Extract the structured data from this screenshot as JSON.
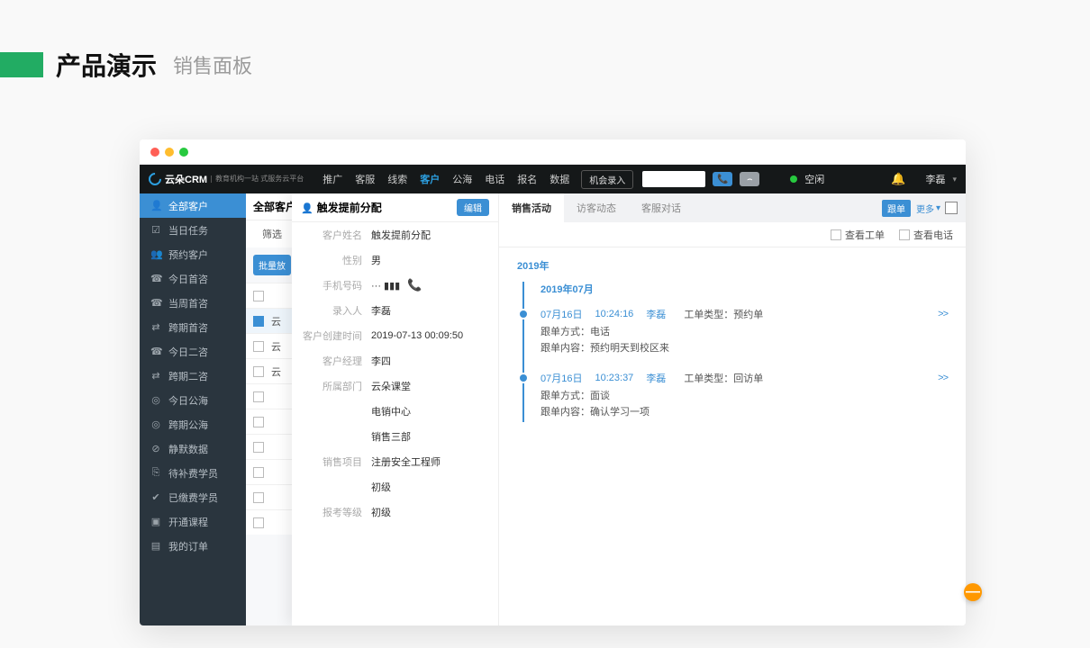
{
  "page": {
    "title_main": "产品演示",
    "title_sub": "销售面板"
  },
  "topnav": {
    "brand_main": "云朵CRM",
    "brand_sub": "教育机构一站\n式服务云平台",
    "items": [
      "推广",
      "客服",
      "线索",
      "客户",
      "公海",
      "电话",
      "报名",
      "数据"
    ],
    "active_index": 3,
    "entry_btn": "机会录入",
    "status_text": "空闲",
    "user": "李磊"
  },
  "sidebar": {
    "items": [
      {
        "icon": "👤",
        "label": "全部客户",
        "active": true
      },
      {
        "icon": "☑",
        "label": "当日任务"
      },
      {
        "icon": "👥",
        "label": "预约客户"
      },
      {
        "icon": "☎",
        "label": "今日首咨"
      },
      {
        "icon": "☎",
        "label": "当周首咨"
      },
      {
        "icon": "⇄",
        "label": "跨期首咨"
      },
      {
        "icon": "☎",
        "label": "今日二咨"
      },
      {
        "icon": "⇄",
        "label": "跨期二咨"
      },
      {
        "icon": "◎",
        "label": "今日公海"
      },
      {
        "icon": "◎",
        "label": "跨期公海"
      },
      {
        "icon": "⊘",
        "label": "静默数据"
      },
      {
        "icon": "⎘",
        "label": "待补费学员"
      },
      {
        "icon": "✔",
        "label": "已缴费学员"
      },
      {
        "icon": "▣",
        "label": "开通课程"
      },
      {
        "icon": "▤",
        "label": "我的订单"
      }
    ]
  },
  "list": {
    "title": "全部客户",
    "filter_label": "筛选",
    "batch_btn": "批量放",
    "rows": [
      {
        "label": "",
        "selected": false
      },
      {
        "label": "云",
        "selected": true
      },
      {
        "label": "云",
        "selected": false
      },
      {
        "label": "云",
        "selected": false
      },
      {
        "label": "",
        "selected": false
      },
      {
        "label": "",
        "selected": false
      },
      {
        "label": "",
        "selected": false
      },
      {
        "label": "",
        "selected": false
      },
      {
        "label": "",
        "selected": false
      },
      {
        "label": "",
        "selected": false
      }
    ]
  },
  "detail": {
    "title": "触发提前分配",
    "edit_label": "编辑",
    "fields": [
      {
        "label": "客户姓名",
        "value": "触发提前分配"
      },
      {
        "label": "性别",
        "value": "男"
      },
      {
        "label": "手机号码",
        "value": "··· ▮▮▮",
        "phone": true
      },
      {
        "label": "录入人",
        "value": "李磊"
      },
      {
        "label": "客户创建时间",
        "value": "2019-07-13 00:09:50"
      },
      {
        "label": "客户经理",
        "value": "李四"
      },
      {
        "label": "所属部门",
        "value": "云朵课堂"
      },
      {
        "label": "",
        "value": "电销中心"
      },
      {
        "label": "",
        "value": "销售三部"
      },
      {
        "label": "销售项目",
        "value": "注册安全工程师"
      },
      {
        "label": "",
        "value": "初级"
      },
      {
        "label": "报考等级",
        "value": "初级"
      }
    ]
  },
  "activity": {
    "tabs": [
      "销售活动",
      "访客动态",
      "客服对话"
    ],
    "active_tab": 0,
    "follow_tag": "跟单",
    "more_label": "更多",
    "check_ticket": "查看工单",
    "check_phone": "查看电话",
    "year_label": "2019年",
    "month_label": "2019年07月",
    "entries": [
      {
        "date": "07月16日",
        "time": "10:24:16",
        "user": "李磊",
        "type_label": "工单类型：",
        "type_value": "预约单",
        "lines": [
          {
            "label": "跟单方式：",
            "value": "电话"
          },
          {
            "label": "跟单内容：",
            "value": "预约明天到校区来"
          }
        ],
        "expand": ">>"
      },
      {
        "date": "07月16日",
        "time": "10:23:37",
        "user": "李磊",
        "type_label": "工单类型：",
        "type_value": "回访单",
        "lines": [
          {
            "label": "跟单方式：",
            "value": "面谈"
          },
          {
            "label": "跟单内容：",
            "value": "确认学习一项"
          }
        ],
        "expand": ">>"
      }
    ]
  },
  "help": "—"
}
